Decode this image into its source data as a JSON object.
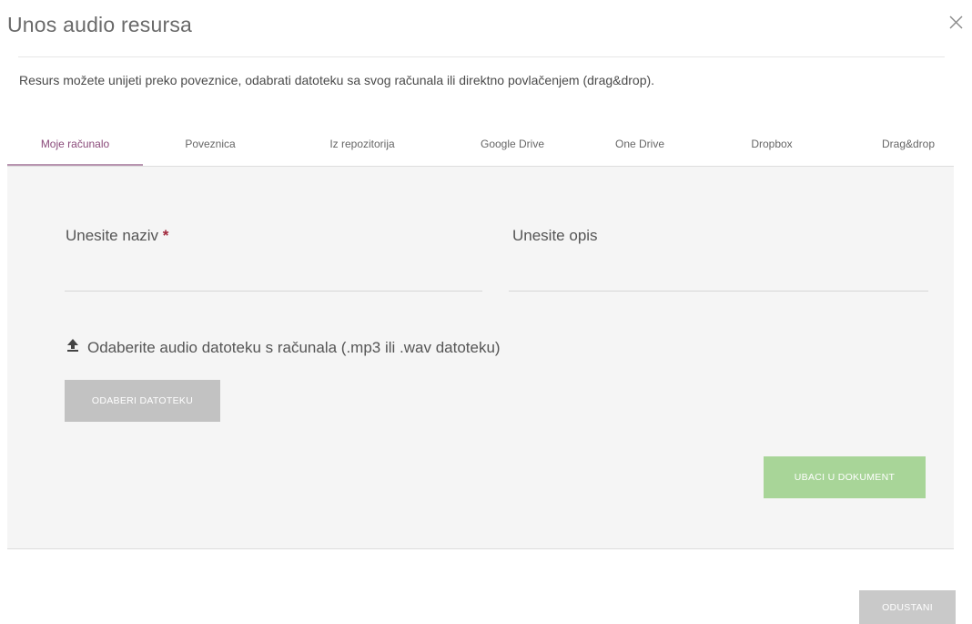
{
  "modal": {
    "title": "Unos audio resursa",
    "close_icon": "close-icon",
    "intro": "Resurs možete unijeti preko poveznice, odabrati datoteku sa svog računala ili direktno povlačenjem (drag&drop)."
  },
  "tabs": [
    {
      "label": "Moje računalo",
      "active": true
    },
    {
      "label": "Poveznica",
      "active": false
    },
    {
      "label": "Iz repozitorija",
      "active": false
    },
    {
      "label": "Google Drive",
      "active": false
    },
    {
      "label": "One Drive",
      "active": false
    },
    {
      "label": "Dropbox",
      "active": false
    },
    {
      "label": "Drag&drop",
      "active": false
    }
  ],
  "form": {
    "name_label": "Unesite naziv",
    "required_mark": "*",
    "name_value": "",
    "description_label": "Unesite opis",
    "description_value": "",
    "upload_icon": "upload-icon",
    "upload_prompt": "Odaberite audio datoteku s računala (.mp3 ili .wav datoteku)",
    "choose_file_button": "ODABERI DATOTEKU",
    "insert_button": "UBACI U DOKUMENT"
  },
  "footer": {
    "cancel_button": "ODUSTANI"
  },
  "colors": {
    "active_tab": "#8a4a7a",
    "tab_underline": "#b895b0",
    "required": "#a0283c",
    "insert_button": "#a8d598",
    "disabled_button": "#c2c2c2",
    "panel_background": "#f5f5f5"
  }
}
